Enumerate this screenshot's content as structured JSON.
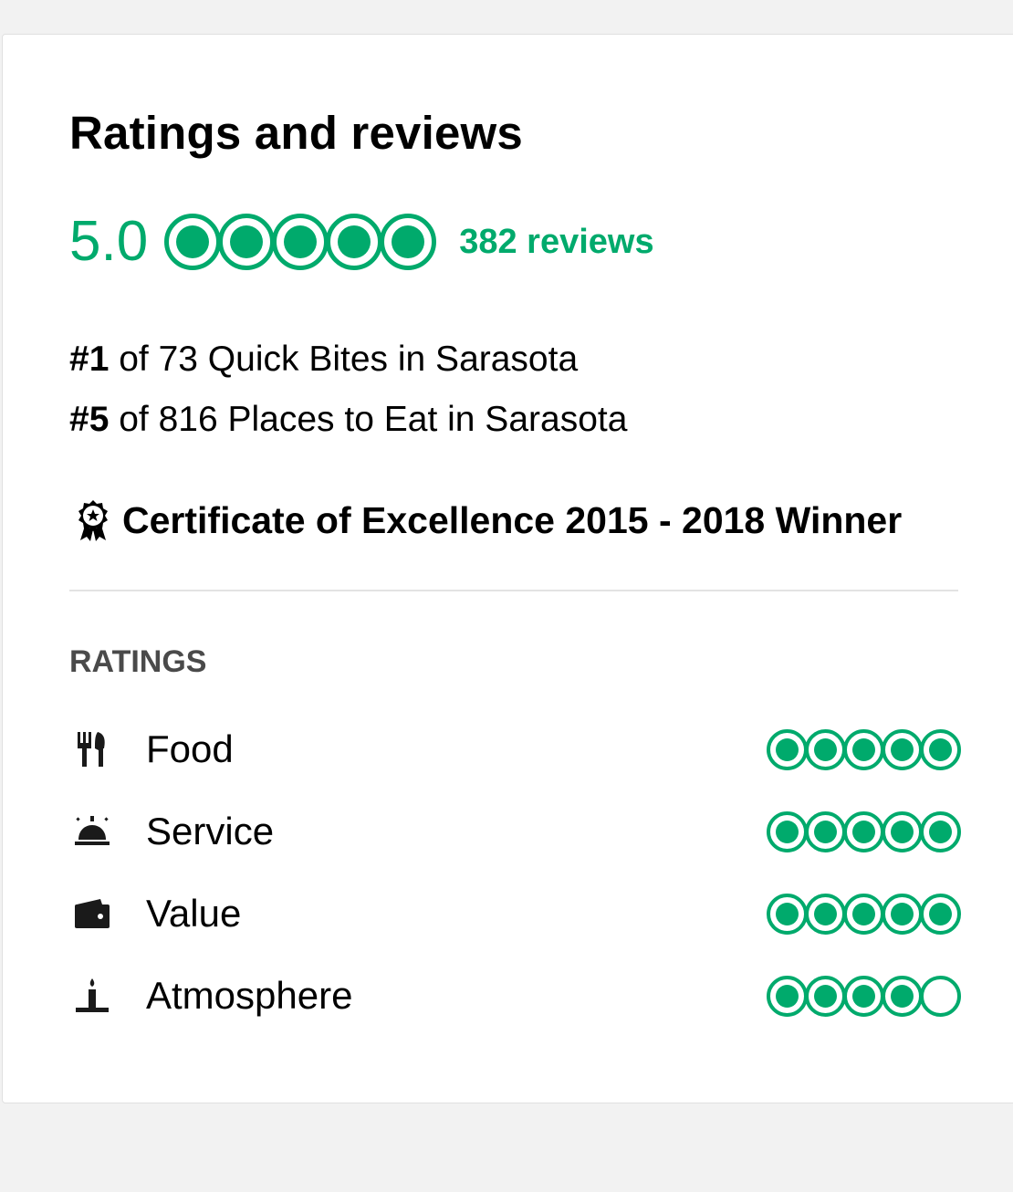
{
  "header": {
    "title": "Ratings and reviews"
  },
  "summary": {
    "score": "5.0",
    "bubble_rating": 5,
    "reviews_label": "382 reviews"
  },
  "rankings": [
    {
      "rank": "#1",
      "text": " of 73 Quick Bites in Sarasota"
    },
    {
      "rank": "#5",
      "text": " of 816 Places to Eat in Sarasota"
    }
  ],
  "award": {
    "text": "Certificate of Excellence 2015 - 2018 Winner",
    "icon": "award-ribbon-icon"
  },
  "ratings": {
    "section_title": "RATINGS",
    "items": [
      {
        "label": "Food",
        "icon": "fork-knife-icon",
        "rating": 5
      },
      {
        "label": "Service",
        "icon": "service-bell-icon",
        "rating": 5
      },
      {
        "label": "Value",
        "icon": "wallet-icon",
        "rating": 5
      },
      {
        "label": "Atmosphere",
        "icon": "candle-icon",
        "rating": 4
      }
    ]
  },
  "colors": {
    "brand_green": "#00aa6c",
    "text": "#000000",
    "section_gray": "#4a4a4a"
  }
}
